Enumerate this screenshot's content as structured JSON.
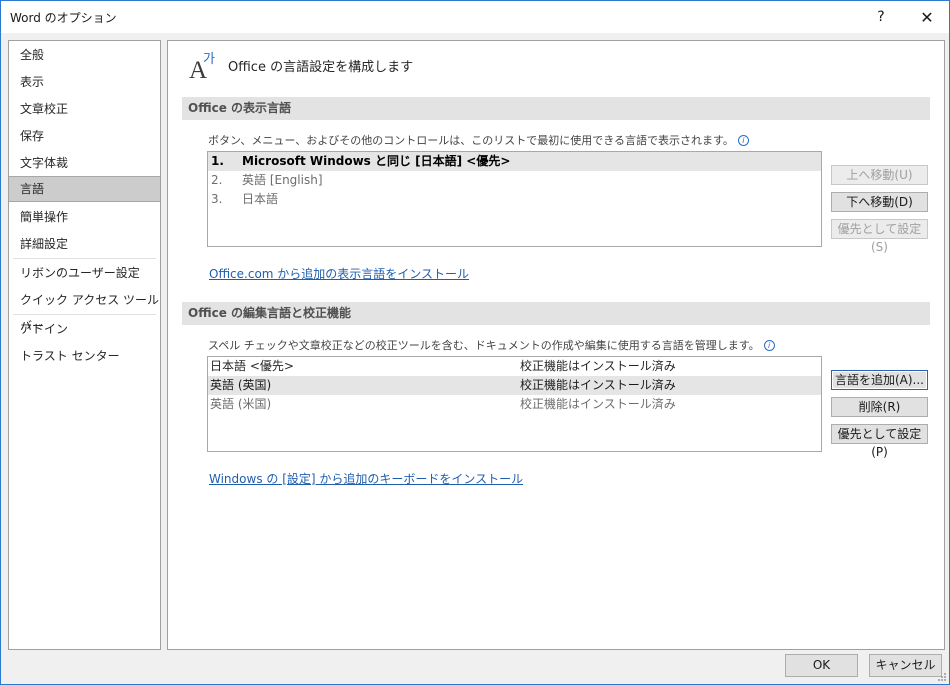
{
  "window": {
    "title": "Word のオプション",
    "help_label": "?",
    "close_label": "✕"
  },
  "nav": {
    "items": [
      {
        "label": "全般"
      },
      {
        "label": "表示"
      },
      {
        "label": "文章校正"
      },
      {
        "label": "保存"
      },
      {
        "label": "文字体裁"
      },
      {
        "label": "言語",
        "selected": true
      },
      {
        "label": "簡単操作"
      },
      {
        "label": "詳細設定"
      },
      {
        "label": "リボンのユーザー設定"
      },
      {
        "label": "クイック アクセス ツール バー"
      },
      {
        "label": "アドイン"
      },
      {
        "label": "トラスト センター"
      }
    ]
  },
  "header": {
    "icon": "language-icon",
    "text": "Office の言語設定を構成します"
  },
  "display_section": {
    "title": "Office の表示言語",
    "description": "ボタン、メニュー、およびその他のコントロールは、このリストで最初に使用できる言語で表示されます。",
    "info_icon": "i",
    "languages": [
      {
        "num": "1.",
        "name": "Microsoft Windows と同じ [日本語] <優先>",
        "selected": true
      },
      {
        "num": "2.",
        "name": "英語 [English]"
      },
      {
        "num": "3.",
        "name": "日本語"
      }
    ],
    "move_up_label": "上へ移動(U)",
    "move_down_label": "下へ移動(D)",
    "set_preferred_label": "優先として設定(S)",
    "install_link": "Office.com から追加の表示言語をインストール"
  },
  "editing_section": {
    "title": "Office の編集言語と校正機能",
    "description": "スペル チェックや文章校正などの校正ツールを含む、ドキュメントの作成や編集に使用する言語を管理します。",
    "info_icon": "i",
    "languages": [
      {
        "lang": "日本語 <優先>",
        "status": "校正機能はインストール済み"
      },
      {
        "lang": "英語 (英国)",
        "status": "校正機能はインストール済み",
        "selected": true
      },
      {
        "lang": "英語 (米国)",
        "status": "校正機能はインストール済み"
      }
    ],
    "add_label": "言語を追加(A)...",
    "remove_label": "削除(R)",
    "set_preferred_label": "優先として設定(P)",
    "keyboard_link": "Windows の [設定] から追加のキーボードをインストール"
  },
  "footer": {
    "ok_label": "OK",
    "cancel_label": "キャンセル"
  }
}
